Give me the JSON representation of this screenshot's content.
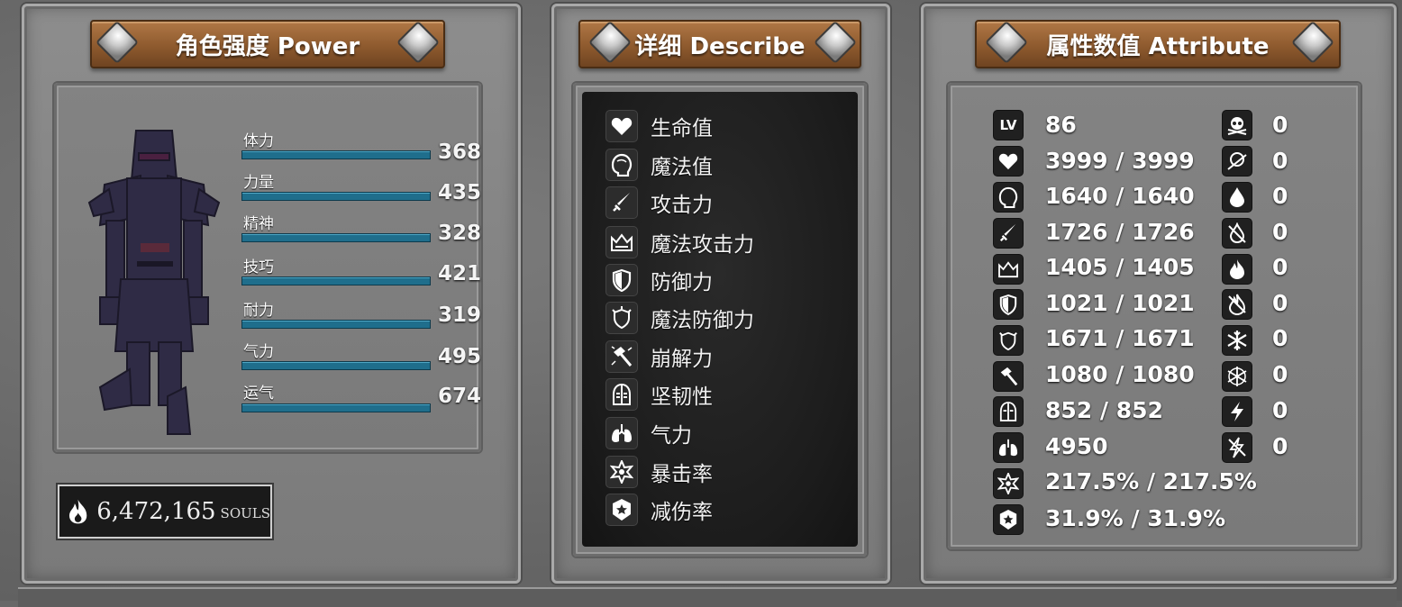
{
  "power_panel": {
    "title": "角色强度 Power",
    "stats": [
      {
        "label": "体力",
        "value": "368"
      },
      {
        "label": "力量",
        "value": "435"
      },
      {
        "label": "精神",
        "value": "328"
      },
      {
        "label": "技巧",
        "value": "421"
      },
      {
        "label": "耐力",
        "value": "319"
      },
      {
        "label": "气力",
        "value": "495"
      },
      {
        "label": "运气",
        "value": "674"
      }
    ],
    "souls": {
      "value": "6,472,165",
      "unit": "SOULS",
      "icon": "flame-icon"
    }
  },
  "describe_panel": {
    "title": "详细 Describe",
    "items": [
      {
        "label": "生命值",
        "icon": "heart-icon"
      },
      {
        "label": "魔法值",
        "icon": "head-icon"
      },
      {
        "label": "攻击力",
        "icon": "sword-icon"
      },
      {
        "label": "魔法攻击力",
        "icon": "crown-magic-icon"
      },
      {
        "label": "防御力",
        "icon": "shield-icon"
      },
      {
        "label": "魔法防御力",
        "icon": "magic-shield-icon"
      },
      {
        "label": "崩解力",
        "icon": "hammer-icon"
      },
      {
        "label": "坚韧性",
        "icon": "helmet-icon"
      },
      {
        "label": "气力",
        "icon": "lungs-icon"
      },
      {
        "label": "暴击率",
        "icon": "star-burst-icon"
      },
      {
        "label": "减伤率",
        "icon": "badge-shield-icon"
      }
    ]
  },
  "attribute_panel": {
    "title": "属性数值 Attribute",
    "left": [
      {
        "icon": "level-icon",
        "icon_text": "LV",
        "value": "86"
      },
      {
        "icon": "heart-icon",
        "value": "3999 / 3999"
      },
      {
        "icon": "head-icon",
        "value": "1640 / 1640"
      },
      {
        "icon": "sword-icon",
        "value": "1726 / 1726"
      },
      {
        "icon": "crown-magic-icon",
        "value": "1405 / 1405"
      },
      {
        "icon": "shield-icon",
        "value": "1021 / 1021"
      },
      {
        "icon": "magic-shield-icon",
        "value": "1671 / 1671"
      },
      {
        "icon": "hammer-icon",
        "value": "1080 / 1080"
      },
      {
        "icon": "helmet-icon",
        "value": "852 / 852"
      },
      {
        "icon": "lungs-icon",
        "value": "4950"
      },
      {
        "icon": "star-burst-icon",
        "value": "217.5% / 217.5%"
      },
      {
        "icon": "badge-shield-icon",
        "value": "31.9% / 31.9%"
      }
    ],
    "right": [
      {
        "icon": "skull-icon",
        "value": "0"
      },
      {
        "icon": "toxic-skull-icon",
        "value": "0"
      },
      {
        "icon": "drop-icon",
        "value": "0"
      },
      {
        "icon": "bleed-icon",
        "value": "0"
      },
      {
        "icon": "fire-icon",
        "value": "0"
      },
      {
        "icon": "fire-resist-icon",
        "value": "0"
      },
      {
        "icon": "frost-icon",
        "value": "0"
      },
      {
        "icon": "frost-resist-icon",
        "value": "0"
      },
      {
        "icon": "lightning-icon",
        "value": "0"
      },
      {
        "icon": "lightning-resist-icon",
        "value": "0"
      }
    ]
  }
}
